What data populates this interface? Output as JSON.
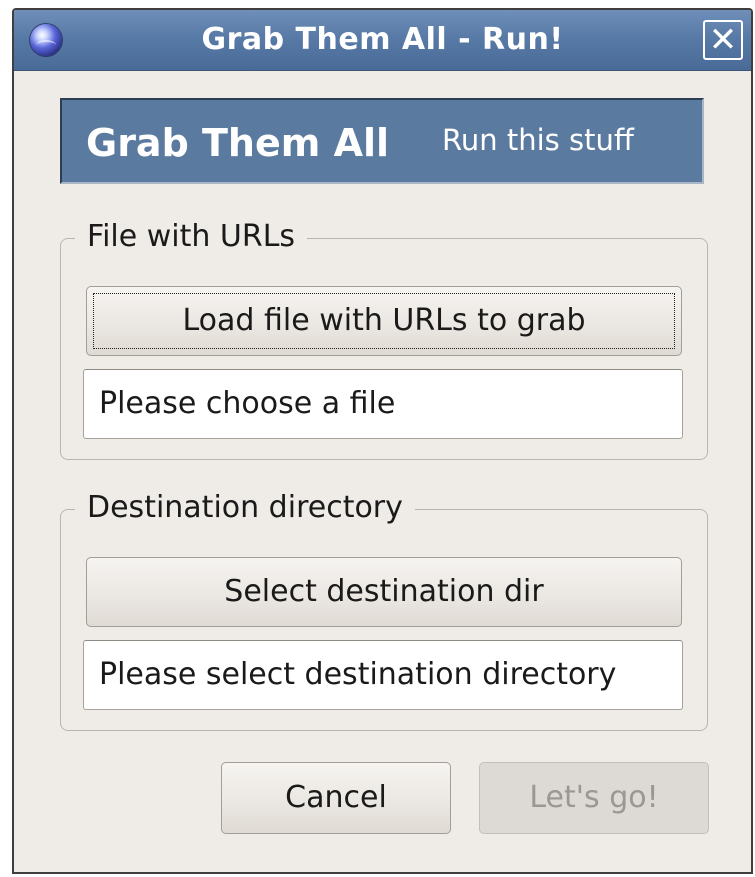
{
  "window": {
    "title": "Grab Them All - Run!",
    "close_glyph": "✕",
    "icon": "globe-app-icon"
  },
  "banner": {
    "title": "Grab Them All",
    "subtitle": "Run this stuff"
  },
  "file_group": {
    "label": "File with URLs",
    "load_button_label": "Load file with URLs to grab",
    "file_field_value": "Please choose a file"
  },
  "dest_group": {
    "label": "Destination directory",
    "select_button_label": "Select destination dir",
    "dir_field_value": "Please select destination directory"
  },
  "actions": {
    "cancel_label": "Cancel",
    "go_label": "Let's go!",
    "go_enabled": false
  },
  "colors": {
    "titlebar": "#587aa6",
    "banner": "#5b7aa0",
    "window_bg": "#efebe7"
  }
}
